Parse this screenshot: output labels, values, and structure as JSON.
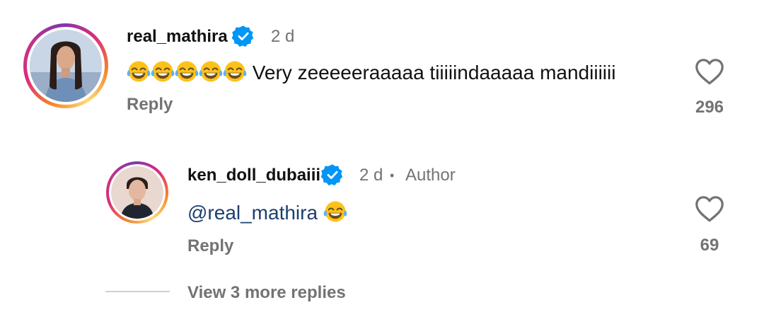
{
  "comments": [
    {
      "username": "real_mathira",
      "time": "2 d",
      "emoji_count": 5,
      "text": "Very zeeeeeraaaaa tiiiiindaaaaa mandiiiiii",
      "reply_label": "Reply",
      "likes": "296"
    }
  ],
  "replies": [
    {
      "username": "ken_doll_dubaiii",
      "time": "2 d",
      "separator": "•",
      "badge": "Author",
      "mention": "@real_mathira",
      "emoji_count": 1,
      "reply_label": "Reply",
      "likes": "69"
    }
  ],
  "view_more_label": "View 3 more replies",
  "icons": {
    "verified": "verified-badge-icon",
    "like": "heart-outline-icon",
    "emoji": "face-with-tears-of-joy-emoji"
  },
  "colors": {
    "verified_blue": "#0095f6",
    "meta_gray": "#737373",
    "mention_blue": "#1c3f6e",
    "emoji_yellow": "#fcc21b"
  }
}
